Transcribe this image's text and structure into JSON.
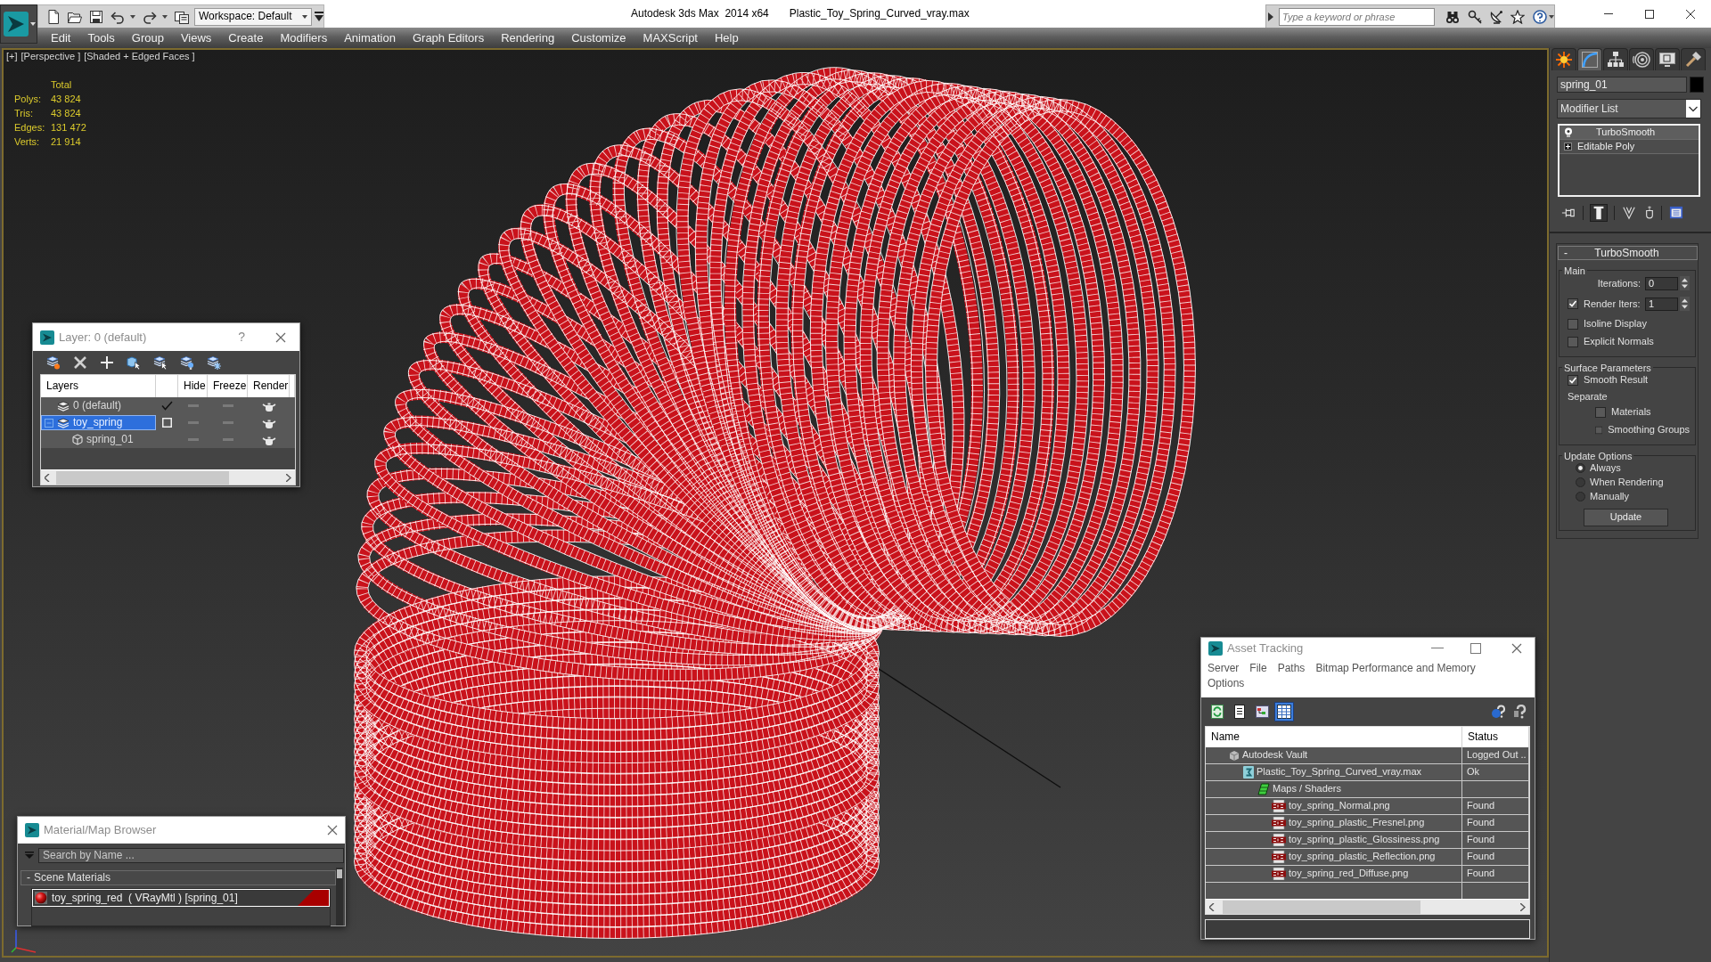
{
  "title_bar": {
    "workspace": "Workspace: Default",
    "app_title": "Autodesk 3ds Max  2014 x64",
    "file_name": "Plastic_Toy_Spring_Curved_vray.max",
    "search": {
      "placeholder": "Type a keyword or phrase"
    }
  },
  "menu_bar": [
    "Edit",
    "Tools",
    "Group",
    "Views",
    "Create",
    "Modifiers",
    "Animation",
    "Graph Editors",
    "Rendering",
    "Customize",
    "MAXScript",
    "Help"
  ],
  "viewport": {
    "labels": [
      "[+]",
      "[Perspective ]",
      "[Shaded + Edged Faces ]"
    ],
    "stats": {
      "heading": "Total",
      "rows": [
        {
          "label": "Polys:",
          "value": "43 824"
        },
        {
          "label": "Tris:",
          "value": "43 824"
        },
        {
          "label": "Edges:",
          "value": "131 472"
        },
        {
          "label": "Verts:",
          "value": "21 914"
        }
      ]
    }
  },
  "layer_dialog": {
    "title": "Layer: 0 (default)",
    "help": "?",
    "columns": [
      "Layers",
      "Hide",
      "Freeze",
      "Render"
    ],
    "layers": [
      {
        "kind": "layer",
        "name": "0 (default)",
        "selected": false,
        "current": true,
        "expanded": false,
        "hidden": false,
        "frozen": false,
        "renderable": true
      },
      {
        "kind": "layer",
        "name": "toy_spring",
        "selected": true,
        "current": false,
        "expanded": true,
        "hidden": false,
        "frozen": false,
        "renderable": true,
        "children": [
          {
            "kind": "object",
            "name": "spring_01",
            "selected": false,
            "hidden": false,
            "frozen": false,
            "renderable": true
          }
        ]
      }
    ]
  },
  "material_browser": {
    "title": "Material/Map Browser",
    "search": {
      "placeholder": "Search by Name ..."
    },
    "groups": [
      {
        "toggle": "-",
        "label": "Scene Materials",
        "items": [
          {
            "name": "toy_spring_red  ( VRayMtl ) [spring_01]",
            "selected": true
          }
        ]
      }
    ]
  },
  "asset_tracking": {
    "title": "Asset Tracking",
    "menus": [
      "Server",
      "File",
      "Paths",
      "Bitmap Performance and Memory",
      "Options"
    ],
    "view_buttons": [
      {
        "kind": "refresh",
        "selected": false
      },
      {
        "kind": "list",
        "selected": false
      },
      {
        "kind": "tree",
        "selected": false
      },
      {
        "kind": "table",
        "selected": true
      }
    ],
    "columns": [
      "Name",
      "Status"
    ],
    "rows": [
      {
        "kind": "vault",
        "name": "Autodesk Vault",
        "status": "Logged Out ..",
        "children": [
          {
            "kind": "scene",
            "name": "Plastic_Toy_Spring_Curved_vray.max",
            "status": "Ok",
            "children": [
              {
                "kind": "maps",
                "name": "Maps / Shaders",
                "children": [
                  {
                    "kind": "image",
                    "name": "toy_spring_Normal.png",
                    "status": "Found"
                  },
                  {
                    "kind": "image",
                    "name": "toy_spring_plastic_Fresnel.png",
                    "status": "Found"
                  },
                  {
                    "kind": "image",
                    "name": "toy_spring_plastic_Glossiness.png",
                    "status": "Found"
                  },
                  {
                    "kind": "image",
                    "name": "toy_spring_plastic_Reflection.png",
                    "status": "Found"
                  },
                  {
                    "kind": "image",
                    "name": "toy_spring_red_Diffuse.png",
                    "status": "Found"
                  }
                ]
              }
            ]
          }
        ]
      }
    ]
  },
  "command_panel": {
    "tabs": [
      {
        "kind": "create",
        "selected": false
      },
      {
        "kind": "modify",
        "selected": true
      },
      {
        "kind": "hierarchy",
        "selected": false
      },
      {
        "kind": "motion",
        "selected": false
      },
      {
        "kind": "display",
        "selected": false
      },
      {
        "kind": "utilities",
        "selected": false
      }
    ],
    "object_name": "spring_01",
    "modifier_list": "Modifier List",
    "stack": [
      {
        "kind": "modifier",
        "name": "TurboSmooth",
        "selected": true
      },
      {
        "kind": "base",
        "name": "Editable Poly",
        "selected": false
      }
    ],
    "stack_tools": [
      {
        "kind": "pin",
        "on": false
      },
      {
        "kind": "end-result",
        "on": true
      },
      {
        "kind": "unique",
        "on": false
      },
      {
        "kind": "remove",
        "on": false
      },
      {
        "kind": "configure",
        "on": false
      }
    ],
    "rollout": {
      "toggle": "-",
      "title": "TurboSmooth",
      "groups": [
        {
          "title": "Main",
          "controls": [
            {
              "kind": "spinner",
              "label": "Iterations:",
              "value": "0"
            },
            {
              "kind": "check-spinner",
              "label": "Render Iters:",
              "checked": true,
              "value": "1"
            },
            {
              "kind": "checkbox",
              "label": "Isoline Display",
              "checked": false
            },
            {
              "kind": "checkbox",
              "label": "Explicit Normals",
              "checked": false
            }
          ]
        },
        {
          "title": "Surface Parameters",
          "controls": [
            {
              "kind": "checkbox",
              "label": "Smooth Result",
              "checked": true
            },
            {
              "kind": "label",
              "label": "Separate",
              "children": [
                {
                  "kind": "checkbox",
                  "label": "Materials",
                  "checked": false
                },
                {
                  "kind": "checkbox",
                  "label": "Smoothing Groups",
                  "checked": false
                }
              ]
            }
          ]
        },
        {
          "title": "Update Options",
          "controls": [
            {
              "kind": "radio",
              "label": "Always",
              "selected": true
            },
            {
              "kind": "radio",
              "label": "When Rendering",
              "selected": false
            },
            {
              "kind": "radio",
              "label": "Manually",
              "selected": false
            },
            {
              "kind": "button",
              "label": "Update"
            }
          ]
        }
      ]
    }
  }
}
